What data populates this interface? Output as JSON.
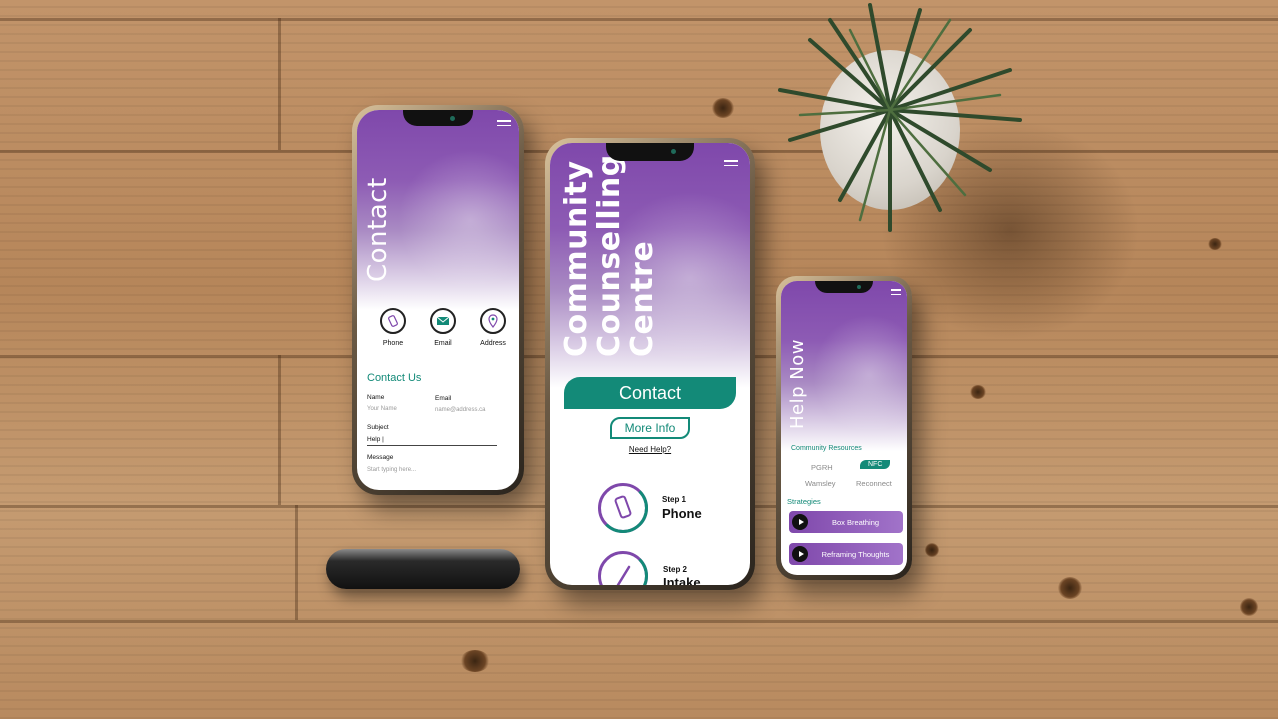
{
  "phone_contact": {
    "title": "Contact",
    "icons": [
      {
        "label": "Phone",
        "icon": "phone-icon"
      },
      {
        "label": "Email",
        "icon": "email-icon"
      },
      {
        "label": "Address",
        "icon": "location-pin-icon"
      }
    ],
    "section_title": "Contact Us",
    "form": {
      "name_label": "Name",
      "name_placeholder": "Your Name",
      "email_label": "Email",
      "email_placeholder": "name@address.ca",
      "subject_label": "Subject",
      "subject_value": "Help |",
      "message_label": "Message",
      "message_placeholder": "Start typing here..."
    }
  },
  "phone_home": {
    "title_lines": [
      "Community",
      "Counselling",
      "Centre"
    ],
    "contact_button": "Contact",
    "more_info_button": "More Info",
    "need_help_link": "Need Help?",
    "steps": [
      {
        "step": "Step 1",
        "name": "Phone"
      },
      {
        "step": "Step 2",
        "name": "Intake"
      }
    ]
  },
  "phone_help": {
    "title": "Help Now",
    "resources_title": "Community Resources",
    "resources": [
      "PGRH",
      "NFC",
      "Wamsley",
      "Reconnect"
    ],
    "active_resource": "NFC",
    "strategies_title": "Strategies",
    "strategies": [
      "Box Breathing",
      "Reframing Thoughts"
    ]
  },
  "colors": {
    "brand_purple": "#7f48ab",
    "brand_teal": "#138a78"
  }
}
